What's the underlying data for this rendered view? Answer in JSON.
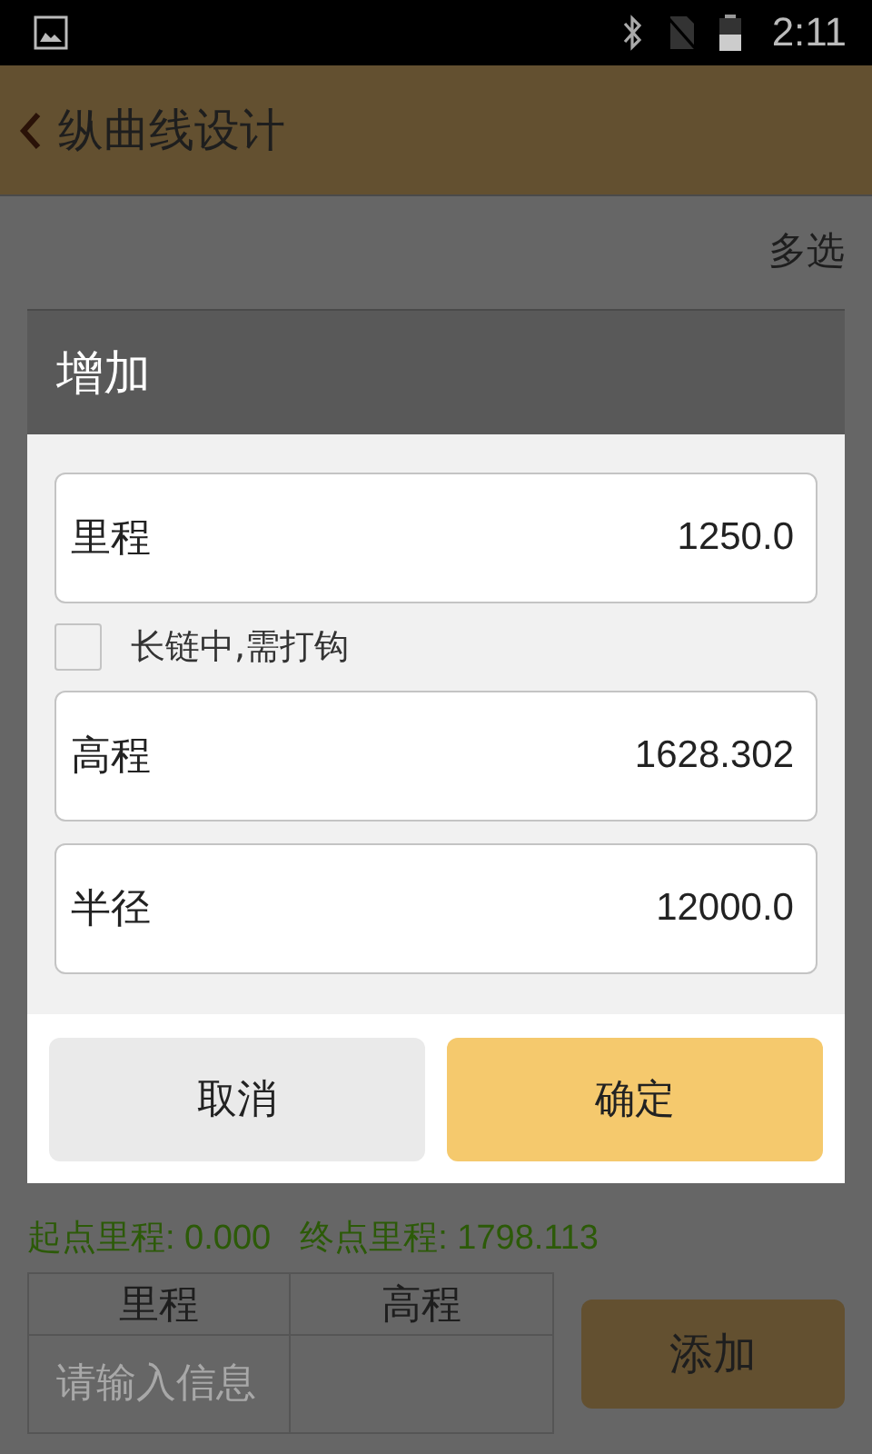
{
  "status_bar": {
    "time": "2:11"
  },
  "app_bar": {
    "title": "纵曲线设计"
  },
  "toolbar": {
    "multi_select": "多选"
  },
  "dialog": {
    "title": "增加",
    "items": [
      {
        "kind": "field",
        "label": "里程",
        "value": "1250.0"
      },
      {
        "kind": "checkbox",
        "label": "长链中,需打钩",
        "checked": false
      },
      {
        "kind": "field",
        "label": "高程",
        "value": "1628.302"
      },
      {
        "kind": "field",
        "label": "半径",
        "value": "12000.0"
      }
    ],
    "buttons": [
      {
        "kind": "cancel",
        "label": "取消"
      },
      {
        "kind": "confirm",
        "label": "确定"
      }
    ]
  },
  "summary": {
    "start": "起点里程: 0.000",
    "end": "终点里程: 1798.113"
  },
  "table": {
    "columns": [
      "里程",
      "高程"
    ],
    "input_placeholder": "请输入信息"
  },
  "add_button": "添加"
}
